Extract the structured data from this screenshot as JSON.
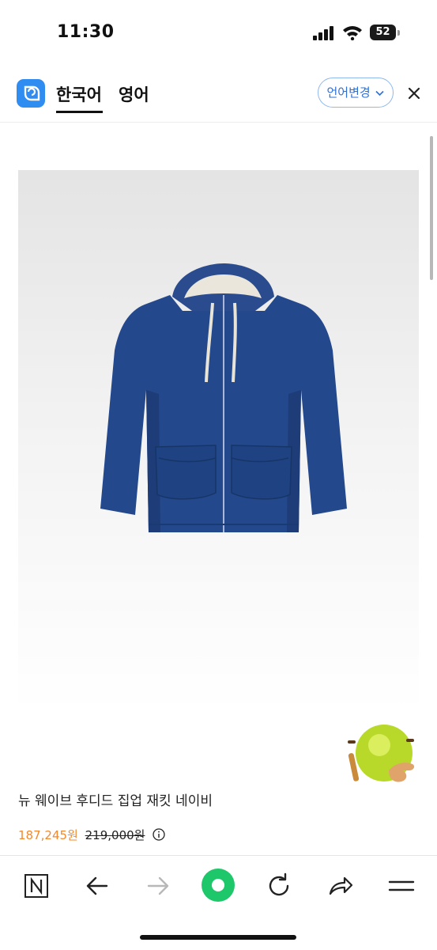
{
  "status_bar": {
    "time": "11:30",
    "battery": "52",
    "battery_level": 0.52
  },
  "header": {
    "tabs": [
      {
        "label": "한국어",
        "selected": true
      },
      {
        "label": "영어",
        "selected": false
      }
    ],
    "language_button": "언어변경",
    "icons": {
      "app": "translate-app-icon",
      "close": "close-icon",
      "dropdown": "chevron-down-icon"
    }
  },
  "product": {
    "name": "뉴 웨이브 후디드 집업 재킷 네이비",
    "price": "187,245원",
    "original_price": "219,000원",
    "image": "navy-hooded-zip-jacket",
    "color": "#23478d"
  },
  "toolbar": {
    "icons": [
      "naver-n-icon",
      "back-arrow-icon",
      "forward-arrow-icon",
      "green-dot-icon",
      "reload-icon",
      "share-icon",
      "menu-icon"
    ],
    "accent": "#1ec86a"
  }
}
